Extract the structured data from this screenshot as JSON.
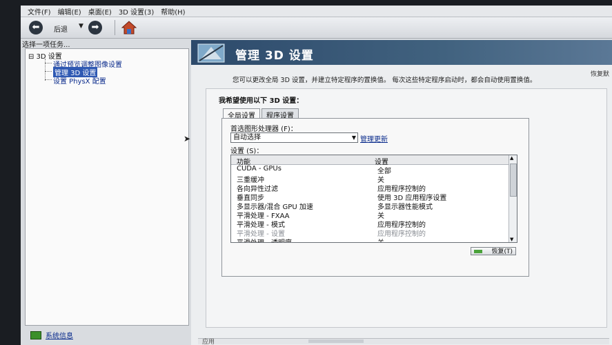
{
  "menu": [
    "文件(F)",
    "编辑(E)",
    "桌面(E)",
    "3D 设置(3)",
    "帮助(H)"
  ],
  "toolbar": {
    "back_label": "后退",
    "back_glyph": "⬅",
    "forward_glyph": "➡",
    "dropdown_glyph": "▼"
  },
  "left": {
    "heading": "选择一项任务...",
    "tree": {
      "root": "⊟ 3D 设置",
      "items": [
        "通过预览调整图像设置",
        "管理 3D 设置",
        "设置 PhysX 配置"
      ]
    },
    "system_info": "系统信息"
  },
  "right": {
    "title": "管理 3D 设置",
    "restore_defaults": "恢复默",
    "description": "您可以更改全局 3D 设置，并建立特定程序的置换值。 每次这些特定程序启动时，都会自动使用置换值。",
    "panel_title": "我希望使用以下 3D 设置：",
    "tabs": [
      "全局设置",
      "程序设置"
    ],
    "processor_label": "首选图形处理器 (F)：",
    "processor_value": "自动选择",
    "manage_link": "管理更新",
    "settings_label": "设置 (S)：",
    "columns": [
      "功能",
      "设置"
    ],
    "rows": [
      {
        "feature": "CUDA - GPUs",
        "value": "全部"
      },
      {
        "feature": "三重缓冲",
        "value": "关"
      },
      {
        "feature": "各向异性过滤",
        "value": "应用程序控制的"
      },
      {
        "feature": "垂直同步",
        "value": "使用 3D 应用程序设置"
      },
      {
        "feature": "多显示器/混合 GPU 加速",
        "value": "多显示器性能模式"
      },
      {
        "feature": "平滑处理 - FXAA",
        "value": "关"
      },
      {
        "feature": "平滑处理 - 模式",
        "value": "应用程序控制的"
      },
      {
        "feature": "平滑处理 - 设置",
        "value": "应用程序控制的",
        "dim": true
      },
      {
        "feature": "平滑处理 - 透明度",
        "value": "关"
      }
    ],
    "restore_button": "恢复(T)",
    "apply_label": "应用"
  },
  "colors": {
    "banner": "#2d4a6b",
    "selection": "#2f59b3",
    "link": "#0a2b8c"
  }
}
